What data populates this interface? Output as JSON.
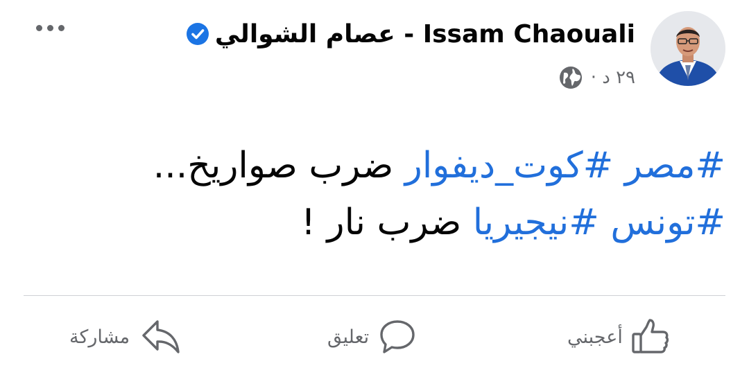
{
  "post": {
    "author": "عصام الشوالي - Issam Chaouali",
    "timestamp": "٢٩ د ·",
    "lines": [
      {
        "hashtags": [
          "#مصر",
          "#كوت_ديفوار"
        ],
        "text": "ضرب صواريخ..."
      },
      {
        "hashtags": [
          "#تونس",
          "#نيجيريا"
        ],
        "text": "ضرب نار !"
      }
    ]
  },
  "actions": {
    "like": "أعجبني",
    "comment": "تعليق",
    "share": "مشاركة"
  },
  "colors": {
    "hashtag": "#216fdb",
    "verified": "#1b74e4",
    "secondary_text": "#65676b"
  },
  "icons": {
    "more": "more-horizontal-icon",
    "verified": "verified-badge-icon",
    "privacy": "globe-icon",
    "like": "thumbs-up-icon",
    "comment": "comment-bubble-icon",
    "share": "share-arrow-icon"
  }
}
